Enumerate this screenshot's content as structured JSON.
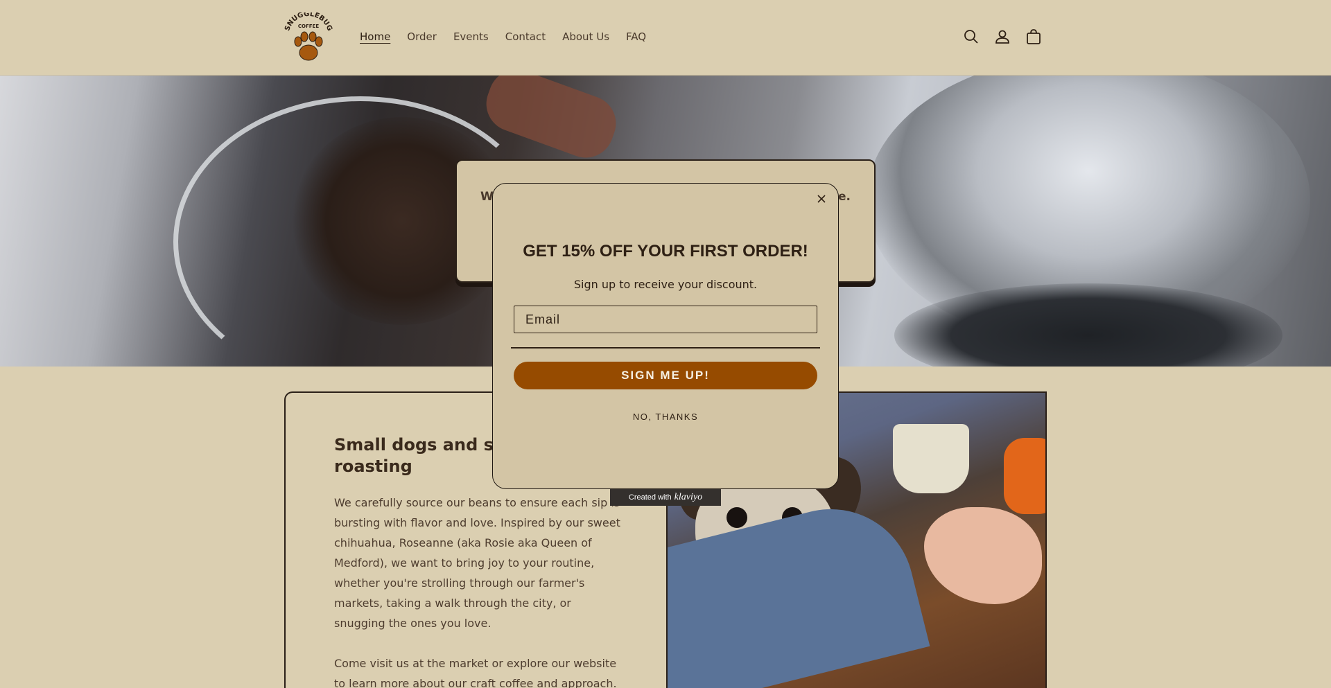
{
  "header": {
    "logo_text_top": "SNUGGLEBUG",
    "logo_text_sub": "COFFEE",
    "nav": [
      {
        "label": "Home",
        "active": true
      },
      {
        "label": "Order",
        "active": false
      },
      {
        "label": "Events",
        "active": false
      },
      {
        "label": "Contact",
        "active": false
      },
      {
        "label": "About Us",
        "active": false
      },
      {
        "label": "FAQ",
        "active": false
      }
    ],
    "icons": [
      "search-icon",
      "account-icon",
      "cart-icon"
    ]
  },
  "hero": {
    "box_text_left": "W",
    "box_text_right": "e."
  },
  "content": {
    "title": "Small dogs and sma… roasting",
    "title_line1": "Small dogs and sma",
    "title_line2": "roasting",
    "paragraph1": "We carefully source our beans to ensure each sip is bursting with flavor and love. Inspired by our sweet chihuahua, Roseanne (aka Rosie aka Queen of Medford), we want to bring joy to your routine, whether you're strolling through our farmer's markets, taking a walk through the city, or snugging the ones you love.",
    "paragraph2": "Come visit us at the market or explore our website to learn more about our craft coffee and approach."
  },
  "modal": {
    "title": "GET 15% OFF YOUR FIRST ORDER!",
    "subtitle": "Sign up to receive your discount.",
    "email_placeholder": "Email",
    "submit_label": "SIGN ME UP!",
    "decline_label": "NO, THANKS",
    "badge_prefix": "Created with",
    "badge_brand": "klaviyo"
  },
  "colors": {
    "background": "#dbcfb1",
    "modal_bg": "#d3c5a5",
    "button": "#964b00",
    "text_dark": "#2e2014"
  }
}
